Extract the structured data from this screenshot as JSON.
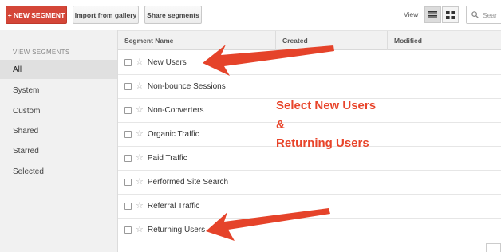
{
  "toolbar": {
    "new_segment_label": "+ NEW SEGMENT",
    "import_label": "Import from gallery",
    "share_label": "Share segments",
    "view_label": "View",
    "search_placeholder": "Sear"
  },
  "sidebar": {
    "heading": "VIEW SEGMENTS",
    "items": [
      {
        "label": "All",
        "active": true
      },
      {
        "label": "System"
      },
      {
        "label": "Custom"
      },
      {
        "label": "Shared"
      },
      {
        "label": "Starred"
      },
      {
        "label": "Selected"
      }
    ]
  },
  "table": {
    "columns": {
      "name": "Segment Name",
      "created": "Created",
      "modified": "Modified"
    },
    "rows": [
      {
        "name": "New Users"
      },
      {
        "name": "Non-bounce Sessions"
      },
      {
        "name": "Non-Converters"
      },
      {
        "name": "Organic Traffic"
      },
      {
        "name": "Paid Traffic"
      },
      {
        "name": "Performed Site Search"
      },
      {
        "name": "Referral Traffic"
      },
      {
        "name": "Returning Users"
      }
    ]
  },
  "annotation": {
    "line1": "Select New Users",
    "line2": "&",
    "line3": "Returning Users",
    "color": "#e8442a"
  },
  "colors": {
    "accent": "#d44638"
  }
}
